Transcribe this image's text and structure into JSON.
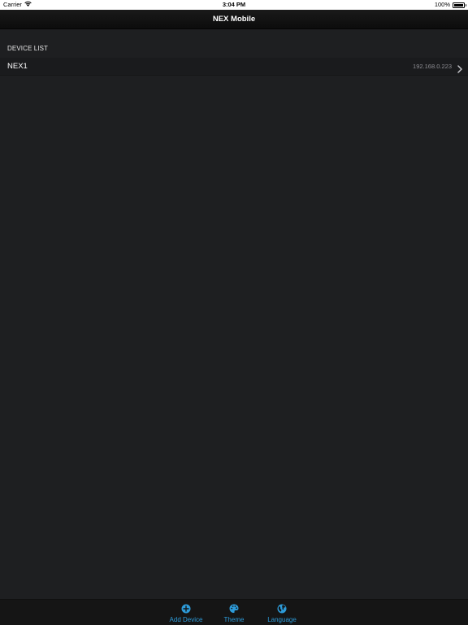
{
  "status_bar": {
    "carrier": "Carrier",
    "time": "3:04 PM",
    "battery": "100%"
  },
  "nav": {
    "title": "NEX Mobile"
  },
  "device_list": {
    "header": "DEVICE LIST",
    "items": [
      {
        "name": "NEX1",
        "ip": "192.168.0.223",
        "icon": "chevron-right-icon"
      }
    ]
  },
  "tab_bar": {
    "accent": "#2d9bd9",
    "items": [
      {
        "label": "Add Device",
        "icon": "add-circle-icon"
      },
      {
        "label": "Theme",
        "icon": "palette-icon"
      },
      {
        "label": "Language",
        "icon": "globe-icon"
      }
    ]
  },
  "colors": {
    "background": "#1e1f21",
    "nav_background": "#111111",
    "row_background": "#1a1b1d",
    "secondary_text": "#8e8e93"
  }
}
